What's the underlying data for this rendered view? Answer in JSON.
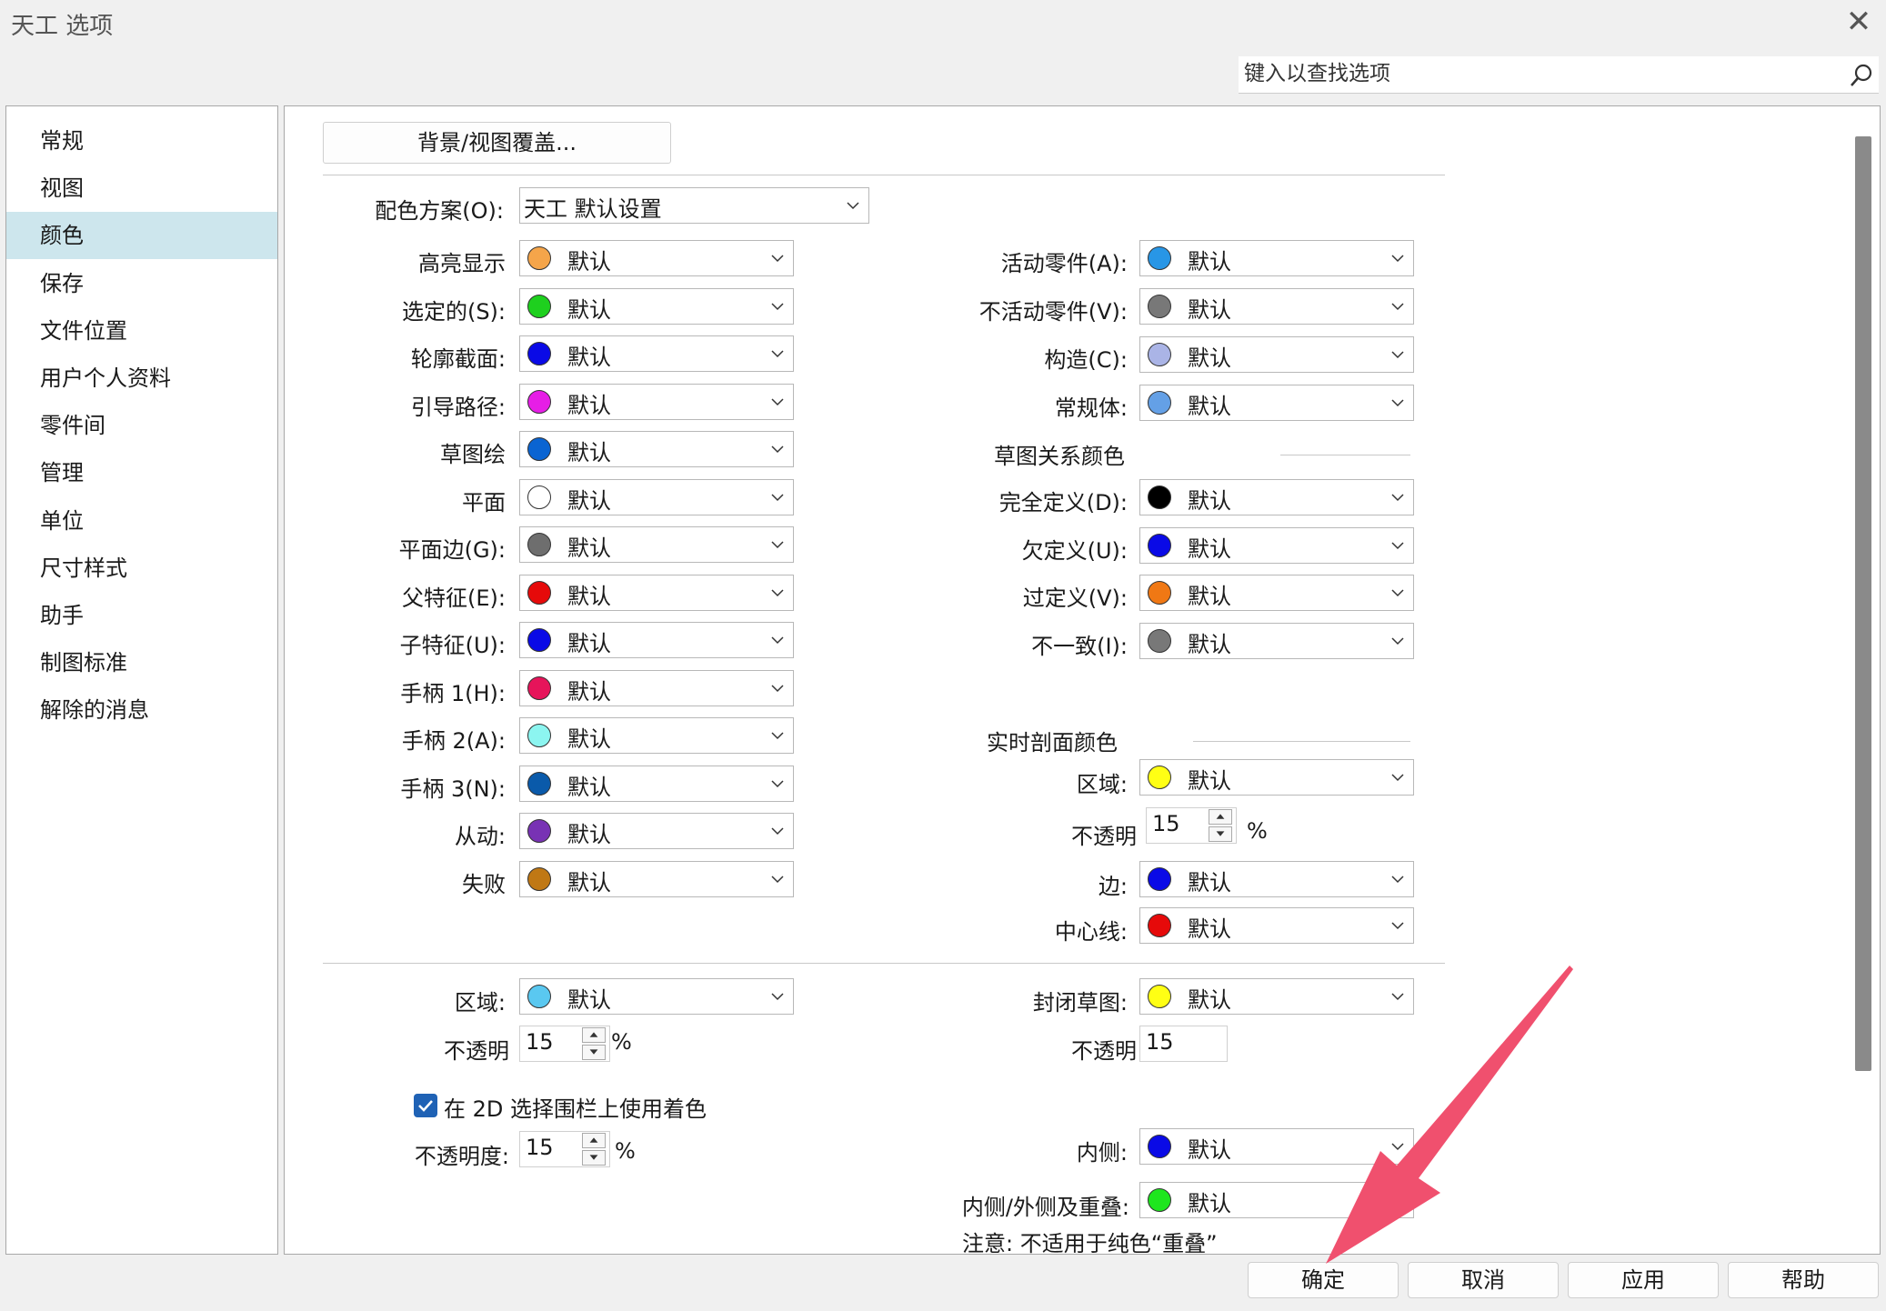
{
  "window": {
    "title": "天工 选项"
  },
  "search": {
    "placeholder": "键入以查找选项"
  },
  "sidebar": {
    "items": [
      {
        "label": "常规"
      },
      {
        "label": "视图"
      },
      {
        "label": "颜色"
      },
      {
        "label": "保存"
      },
      {
        "label": "文件位置"
      },
      {
        "label": "用户个人资料"
      },
      {
        "label": "零件间"
      },
      {
        "label": "管理"
      },
      {
        "label": "单位"
      },
      {
        "label": "尺寸样式"
      },
      {
        "label": "助手"
      },
      {
        "label": "制图标准"
      },
      {
        "label": "解除的消息"
      }
    ],
    "selected": "颜色"
  },
  "panel": {
    "bg_button": "背景/视图覆盖...",
    "scheme_label": "配色方案(O):",
    "scheme_value": "天工 默认设置",
    "default_text": "默认",
    "left_colors": [
      {
        "label": "高亮显示",
        "color": "#f5a54a"
      },
      {
        "label": "选定的(S):",
        "color": "#1ed01e"
      },
      {
        "label": "轮廓截面:",
        "color": "#0a0ae6"
      },
      {
        "label": "引导路径:",
        "color": "#e61ee6"
      },
      {
        "label": "草图绘",
        "color": "#0a64d2"
      },
      {
        "label": "平面",
        "color": "#ffffff"
      },
      {
        "label": "平面边(G):",
        "color": "#6e6e6e"
      },
      {
        "label": "父特征(E):",
        "color": "#e60a0a"
      },
      {
        "label": "子特征(U):",
        "color": "#0a0ae6"
      },
      {
        "label": "手柄 1(H):",
        "color": "#e6145a"
      },
      {
        "label": "手柄 2(A):",
        "color": "#8cf5f0"
      },
      {
        "label": "手柄 3(N):",
        "color": "#0a5aaa"
      },
      {
        "label": "从动:",
        "color": "#7832b4"
      },
      {
        "label": "失败",
        "color": "#c07814"
      }
    ],
    "right_colors": [
      {
        "label": "活动零件(A):",
        "color": "#2896e6"
      },
      {
        "label": "不活动零件(V):",
        "color": "#787878"
      },
      {
        "label": "构造(C):",
        "color": "#aab4e6"
      },
      {
        "label": "常规体:",
        "color": "#64a0e6"
      }
    ],
    "sketch_section": "草图关系颜色",
    "sketch_colors": [
      {
        "label": "完全定义(D):",
        "color": "#000000"
      },
      {
        "label": "欠定义(U):",
        "color": "#0a0ae6"
      },
      {
        "label": "过定义(V):",
        "color": "#f07814"
      },
      {
        "label": "不一致(I):",
        "color": "#787878"
      }
    ],
    "live_section": "实时剖面颜色",
    "live_region": {
      "label": "区域:",
      "color": "#ffff14"
    },
    "live_opacity": {
      "label": "不透明",
      "value": "15",
      "unit": "%"
    },
    "live_edge": {
      "label": "边:",
      "color": "#0a0ae6"
    },
    "live_center": {
      "label": "中心线:",
      "color": "#e60a0a"
    },
    "bottom_region": {
      "label": "区域:",
      "color": "#5ac8f0"
    },
    "bottom_opacity": {
      "label": "不透明",
      "value": "15",
      "unit": "%"
    },
    "closed_sketch": {
      "label": "封闭草图:",
      "color": "#ffff14"
    },
    "closed_opacity": {
      "label": "不透明",
      "value": "15"
    },
    "checkbox_label": "在 2D 选择围栏上使用着色",
    "fence_opacity": {
      "label": "不透明度:",
      "value": "15",
      "unit": "%"
    },
    "inside": {
      "label": "内侧:",
      "color": "#0a0ae6"
    },
    "inside_outside": {
      "label": "内侧/外侧及重叠:",
      "color": "#1ee61e"
    },
    "note": "注意: 不适用于纯色“重叠”"
  },
  "buttons": {
    "ok": "确定",
    "cancel": "取消",
    "apply": "应用",
    "help": "帮助"
  },
  "annotation": {
    "arrow_color": "#f0506e"
  }
}
